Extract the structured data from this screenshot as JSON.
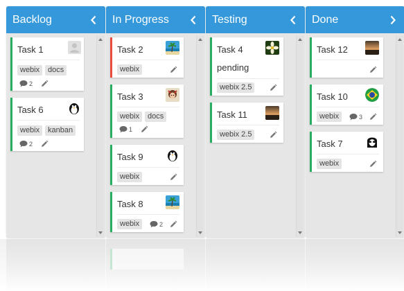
{
  "columns": [
    {
      "title": "Backlog",
      "chevron": "chevron-left"
    },
    {
      "title": "In Progress",
      "chevron": "chevron-left"
    },
    {
      "title": "Testing",
      "chevron": "chevron-left"
    },
    {
      "title": "Done",
      "chevron": "chevron-right"
    }
  ],
  "cards": {
    "task1": {
      "name": "Task 1",
      "tags": [
        "webix",
        "docs"
      ],
      "comments": "2",
      "avatar": "default-user"
    },
    "task6": {
      "name": "Task 6",
      "tags": [
        "webix",
        "kanban"
      ],
      "comments": "2",
      "avatar": "penguin"
    },
    "task2": {
      "name": "Task 2",
      "tags": [
        "webix"
      ],
      "avatar": "palm-beach"
    },
    "task3": {
      "name": "Task 3",
      "tags": [
        "webix",
        "docs"
      ],
      "comments": "1",
      "avatar": "doll"
    },
    "task9": {
      "name": "Task 9",
      "tags": [
        "webix"
      ],
      "avatar": "penguin"
    },
    "task8": {
      "name": "Task 8",
      "tags": [
        "webix"
      ],
      "comments": "2",
      "avatar": "palm-beach"
    },
    "task4": {
      "name": "Task 4",
      "status": "pending",
      "tags": [
        "webix 2.5"
      ],
      "avatar": "flower"
    },
    "task11": {
      "name": "Task 11",
      "tags": [
        "webix 2.5"
      ],
      "avatar": "sunset"
    },
    "task12": {
      "name": "Task 12",
      "tags": [],
      "avatar": "sunset"
    },
    "task10": {
      "name": "Task 10",
      "tags": [
        "webix"
      ],
      "comments": "3",
      "avatar": "brazil-flag"
    },
    "task7": {
      "name": "Task 7",
      "tags": [
        "webix"
      ],
      "avatar": "sunglasses"
    }
  },
  "colors": {
    "header": "#3498db",
    "normal_stripe": "#27ae60",
    "urgent_stripe": "#e74c3c",
    "column_bg": "#e6e6e6"
  }
}
